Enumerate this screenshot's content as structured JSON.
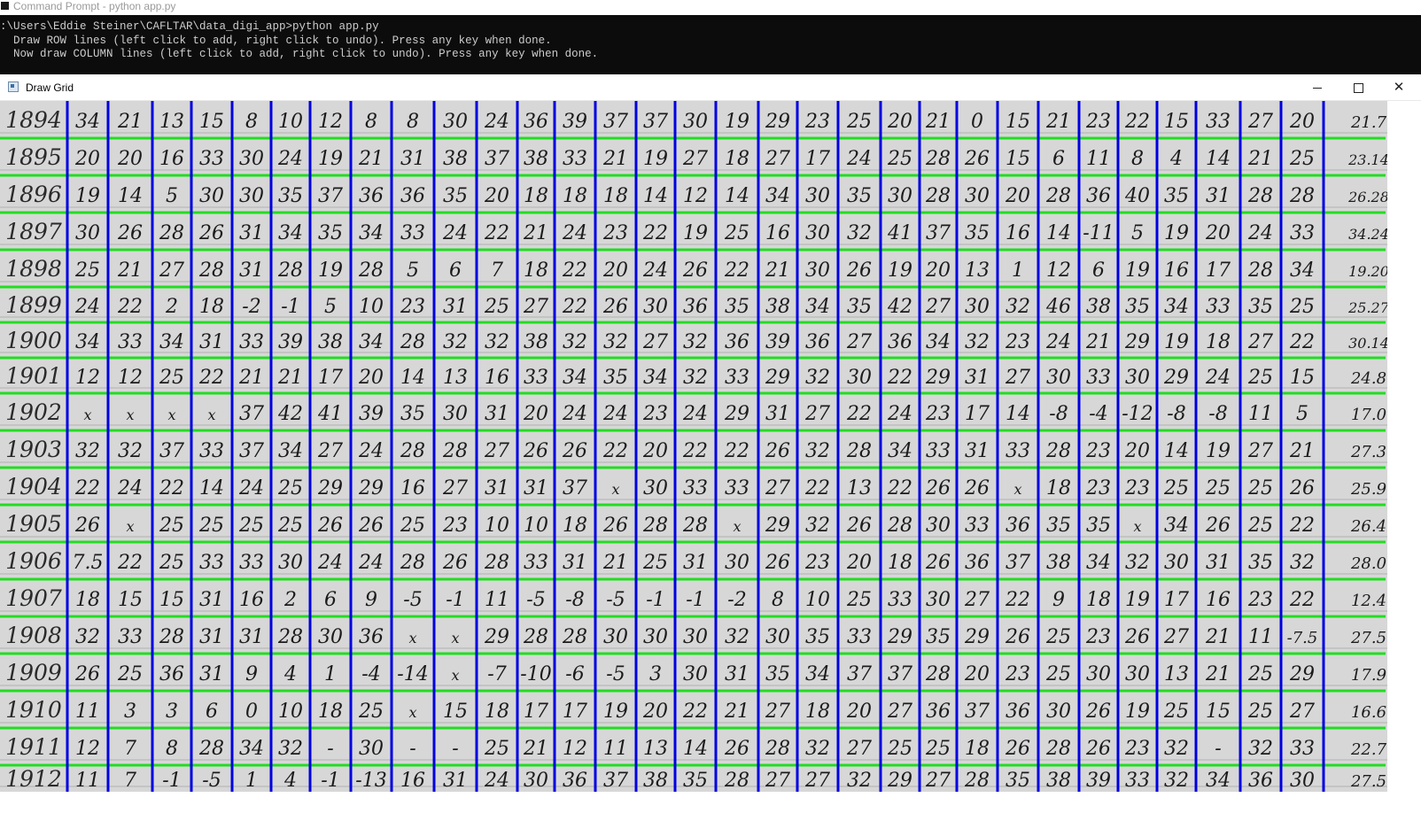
{
  "cmd_window": {
    "title": "Command Prompt - python  app.py",
    "console_lines": [
      ":\\Users\\Eddie Steiner\\CAFLTAR\\data_digi_app>python app.py",
      "  Draw ROW lines (left click to add, right click to undo). Press any key when done.",
      "  Now draw COLUMN lines (left click to add, right click to undo). Press any key when done."
    ]
  },
  "grid_window": {
    "title": "Draw Grid",
    "controls": {
      "minimize_icon": "minimize-icon",
      "maximize_icon": "maximize-icon",
      "close_icon": "close-icon"
    }
  },
  "colors": {
    "row_line": "#22dd22",
    "column_line": "#0000e0",
    "paper": "#cfcfcf",
    "ink": "#1b1b1b"
  },
  "ledger": {
    "rows": [
      {
        "year": "1894",
        "cells": [
          "34",
          "21",
          "13",
          "15",
          "8",
          "10",
          "12",
          "8",
          "8",
          "30",
          "24",
          "36",
          "39",
          "37",
          "37",
          "30",
          "19",
          "29",
          "23",
          "25",
          "20",
          "21",
          "0",
          "15",
          "21",
          "23",
          "22",
          "15",
          "33",
          "27",
          "20",
          "21.7"
        ]
      },
      {
        "year": "1895",
        "cells": [
          "20",
          "20",
          "16",
          "33",
          "30",
          "24",
          "19",
          "21",
          "31",
          "38",
          "37",
          "38",
          "33",
          "21",
          "19",
          "27",
          "18",
          "27",
          "17",
          "24",
          "25",
          "28",
          "26",
          "15",
          "6",
          "11",
          "8",
          "4",
          "14",
          "21",
          "25",
          "23.14"
        ]
      },
      {
        "year": "1896",
        "cells": [
          "19",
          "14",
          "5",
          "30",
          "30",
          "35",
          "37",
          "36",
          "36",
          "35",
          "20",
          "18",
          "18",
          "18",
          "14",
          "12",
          "14",
          "34",
          "30",
          "35",
          "30",
          "28",
          "30",
          "20",
          "28",
          "36",
          "40",
          "35",
          "31",
          "28",
          "28",
          "26.28"
        ]
      },
      {
        "year": "1897",
        "cells": [
          "30",
          "26",
          "28",
          "26",
          "31",
          "34",
          "35",
          "34",
          "33",
          "24",
          "22",
          "21",
          "24",
          "23",
          "22",
          "19",
          "25",
          "16",
          "30",
          "32",
          "41",
          "37",
          "35",
          "16",
          "14",
          "-11",
          "5",
          "19",
          "20",
          "24",
          "33",
          "34.24"
        ]
      },
      {
        "year": "1898",
        "cells": [
          "25",
          "21",
          "27",
          "28",
          "31",
          "28",
          "19",
          "28",
          "5",
          "6",
          "7",
          "18",
          "22",
          "20",
          "24",
          "26",
          "22",
          "21",
          "30",
          "26",
          "19",
          "20",
          "13",
          "1",
          "12",
          "6",
          "19",
          "16",
          "17",
          "28",
          "34",
          "19.20"
        ]
      },
      {
        "year": "1899",
        "cells": [
          "24",
          "22",
          "2",
          "18",
          "-2",
          "-1",
          "5",
          "10",
          "23",
          "31",
          "25",
          "27",
          "22",
          "26",
          "30",
          "36",
          "35",
          "38",
          "34",
          "35",
          "42",
          "27",
          "30",
          "32",
          "46",
          "38",
          "35",
          "34",
          "33",
          "35",
          "25",
          "25.27"
        ]
      },
      {
        "year": "1900",
        "cells": [
          "34",
          "33",
          "34",
          "31",
          "33",
          "39",
          "38",
          "34",
          "28",
          "32",
          "32",
          "38",
          "32",
          "32",
          "27",
          "32",
          "36",
          "39",
          "36",
          "27",
          "36",
          "34",
          "32",
          "23",
          "24",
          "21",
          "29",
          "19",
          "18",
          "27",
          "22",
          "30.14"
        ]
      },
      {
        "year": "1901",
        "cells": [
          "12",
          "12",
          "25",
          "22",
          "21",
          "21",
          "17",
          "20",
          "14",
          "13",
          "16",
          "33",
          "34",
          "35",
          "34",
          "32",
          "33",
          "29",
          "32",
          "30",
          "22",
          "29",
          "31",
          "27",
          "30",
          "33",
          "30",
          "29",
          "24",
          "25",
          "15",
          "24.8"
        ]
      },
      {
        "year": "1902",
        "cells": [
          "x",
          "x",
          "x",
          "x",
          "37",
          "42",
          "41",
          "39",
          "35",
          "30",
          "31",
          "20",
          "24",
          "24",
          "23",
          "24",
          "29",
          "31",
          "27",
          "22",
          "24",
          "23",
          "17",
          "14",
          "-8",
          "-4",
          "-12",
          "-8",
          "-8",
          "11",
          "5",
          "17.0"
        ]
      },
      {
        "year": "1903",
        "cells": [
          "32",
          "32",
          "37",
          "33",
          "37",
          "34",
          "27",
          "24",
          "28",
          "28",
          "27",
          "26",
          "26",
          "22",
          "20",
          "22",
          "22",
          "26",
          "32",
          "28",
          "34",
          "33",
          "31",
          "33",
          "28",
          "23",
          "20",
          "14",
          "19",
          "27",
          "21",
          "27.3"
        ]
      },
      {
        "year": "1904",
        "cells": [
          "22",
          "24",
          "22",
          "14",
          "24",
          "25",
          "29",
          "29",
          "16",
          "27",
          "31",
          "31",
          "37",
          "x",
          "30",
          "33",
          "33",
          "27",
          "22",
          "13",
          "22",
          "26",
          "26",
          "x",
          "18",
          "23",
          "23",
          "25",
          "25",
          "25",
          "26",
          "25.9"
        ]
      },
      {
        "year": "1905",
        "cells": [
          "26",
          "x",
          "25",
          "25",
          "25",
          "25",
          "26",
          "26",
          "25",
          "23",
          "10",
          "10",
          "18",
          "26",
          "28",
          "28",
          "x",
          "29",
          "32",
          "26",
          "28",
          "30",
          "33",
          "36",
          "35",
          "35",
          "x",
          "34",
          "26",
          "25",
          "22",
          "26.4"
        ]
      },
      {
        "year": "1906",
        "cells": [
          "7.5",
          "22",
          "25",
          "33",
          "33",
          "30",
          "24",
          "24",
          "28",
          "26",
          "28",
          "33",
          "31",
          "21",
          "25",
          "31",
          "30",
          "26",
          "23",
          "20",
          "18",
          "26",
          "36",
          "37",
          "38",
          "34",
          "32",
          "30",
          "31",
          "35",
          "32",
          "28.0"
        ]
      },
      {
        "year": "1907",
        "cells": [
          "18",
          "15",
          "15",
          "31",
          "16",
          "2",
          "6",
          "9",
          "-5",
          "-1",
          "11",
          "-5",
          "-8",
          "-5",
          "-1",
          "-1",
          "-2",
          "8",
          "10",
          "25",
          "33",
          "30",
          "27",
          "22",
          "9",
          "18",
          "19",
          "17",
          "16",
          "23",
          "22",
          "12.4"
        ]
      },
      {
        "year": "1908",
        "cells": [
          "32",
          "33",
          "28",
          "31",
          "31",
          "28",
          "30",
          "36",
          "x",
          "x",
          "29",
          "28",
          "28",
          "30",
          "30",
          "30",
          "32",
          "30",
          "35",
          "33",
          "29",
          "35",
          "29",
          "26",
          "25",
          "23",
          "26",
          "27",
          "21",
          "11",
          "-7.5",
          "27.5"
        ]
      },
      {
        "year": "1909",
        "cells": [
          "26",
          "25",
          "36",
          "31",
          "9",
          "4",
          "1",
          "-4",
          "-14",
          "x",
          "-7",
          "-10",
          "-6",
          "-5",
          "3",
          "30",
          "31",
          "35",
          "34",
          "37",
          "37",
          "28",
          "20",
          "23",
          "25",
          "30",
          "30",
          "13",
          "21",
          "25",
          "29",
          "17.9"
        ]
      },
      {
        "year": "1910",
        "cells": [
          "11",
          "3",
          "3",
          "6",
          "0",
          "10",
          "18",
          "25",
          "x",
          "15",
          "18",
          "17",
          "17",
          "19",
          "20",
          "22",
          "21",
          "27",
          "18",
          "20",
          "27",
          "36",
          "37",
          "36",
          "30",
          "26",
          "19",
          "25",
          "15",
          "25",
          "27",
          "16.6"
        ]
      },
      {
        "year": "1911",
        "cells": [
          "12",
          "7",
          "8",
          "28",
          "34",
          "32",
          "-",
          "30",
          "-",
          "-",
          "25",
          "21",
          "12",
          "11",
          "13",
          "14",
          "26",
          "28",
          "32",
          "27",
          "25",
          "25",
          "18",
          "26",
          "28",
          "26",
          "23",
          "32",
          "-",
          "32",
          "33",
          "22.7"
        ]
      },
      {
        "year": "1912",
        "cells": [
          "11",
          "7",
          "-1",
          "-5",
          "1",
          "4",
          "-1",
          "-13",
          "16",
          "31",
          "24",
          "30",
          "36",
          "37",
          "38",
          "35",
          "28",
          "27",
          "27",
          "32",
          "29",
          "27",
          "28",
          "35",
          "38",
          "39",
          "33",
          "32",
          "34",
          "36",
          "30",
          "27.5"
        ]
      }
    ]
  }
}
